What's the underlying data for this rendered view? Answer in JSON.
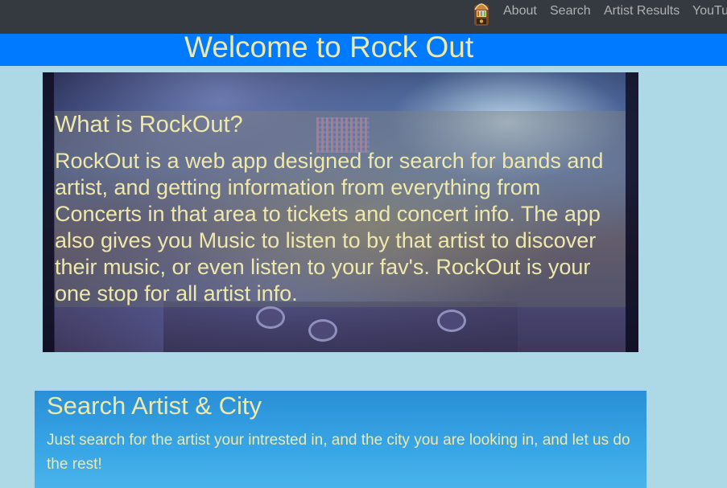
{
  "navbar": {
    "brand_icon": "jukebox-icon",
    "links": [
      {
        "label": "About"
      },
      {
        "label": "Search"
      },
      {
        "label": "Artist Results"
      },
      {
        "label": "YouTu"
      }
    ]
  },
  "banner": {
    "title": "Welcome to Rock Out"
  },
  "hero": {
    "title": "What is RockOut?",
    "text": "RockOut is a web app designed for search for bands and artist, and getting information from everything from Concerts in that area to tickets and concert info. The app also gives you Music to listen to by that artist to discover their music, or even listen to your fav's. RockOut is your one stop for all artist info.",
    "background_image": "concert-crowd-dj-image"
  },
  "search_section": {
    "title": "Search Artist & City",
    "description": "Just search for the artist your intrested in, and the city you are looking in, and let us do the rest!"
  },
  "colors": {
    "navbar_bg": "#343a40",
    "banner_bg": "#007bff",
    "page_bg": "#add8e6",
    "accent_text": "#eee8aa",
    "nav_text": "rgba(255,255,255,0.6)"
  }
}
